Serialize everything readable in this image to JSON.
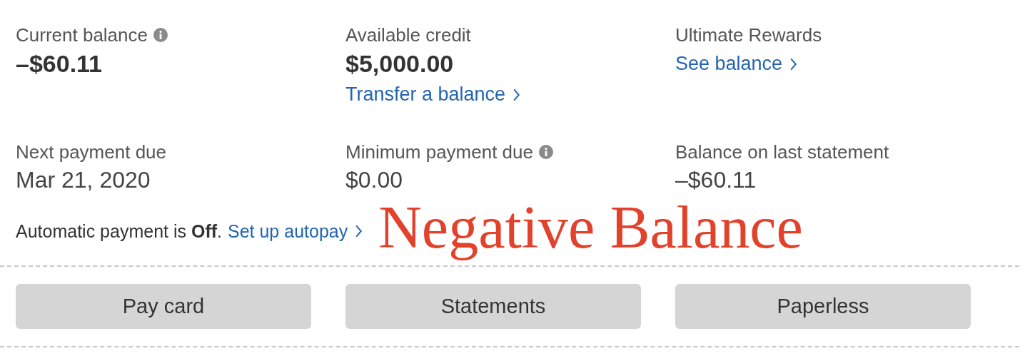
{
  "summary_rows": [
    [
      {
        "label": "Current balance",
        "info": true,
        "value": "–$60.11",
        "kind": "bold"
      },
      {
        "label": "Available credit",
        "info": false,
        "value": "$5,000.00",
        "kind": "bold",
        "link": "Transfer a balance"
      },
      {
        "label": "Ultimate Rewards",
        "info": false,
        "link": "See balance"
      }
    ],
    [
      {
        "label": "Next payment due",
        "info": false,
        "value": "Mar 21, 2020",
        "kind": "plain"
      },
      {
        "label": "Minimum payment due",
        "info": true,
        "value": "$0.00",
        "kind": "plain"
      },
      {
        "label": "Balance on last statement",
        "info": false,
        "value": "–$60.11",
        "kind": "plain"
      }
    ]
  ],
  "autopay": {
    "text": "Automatic payment is **Off**.",
    "link": "Set up autopay"
  },
  "annotation": "Negative Balance",
  "buttons": [
    "Pay card",
    "Statements",
    "Paperless"
  ]
}
